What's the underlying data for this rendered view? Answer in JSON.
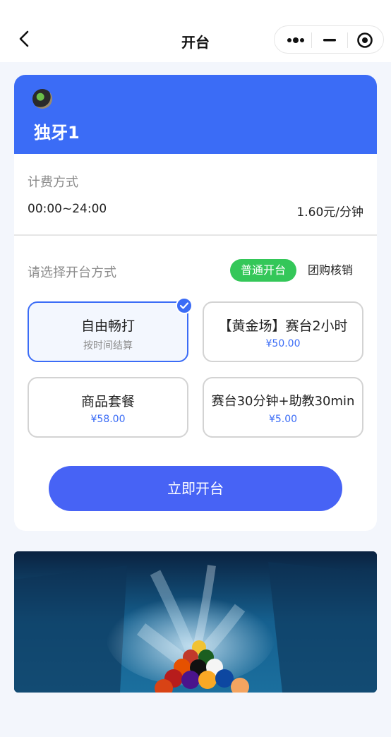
{
  "nav": {
    "title": "开台"
  },
  "table": {
    "name": "独牙1"
  },
  "billing": {
    "title": "计费方式",
    "time_range": "00:00~24:00",
    "price": "1.60元/分钟"
  },
  "mode": {
    "title": "请选择开台方式",
    "tabs": [
      "普通开台",
      "团购核销"
    ],
    "selected_tab": "普通开台"
  },
  "options": [
    {
      "name": "自由畅打",
      "sub": "按时间结算",
      "selected": true
    },
    {
      "name": "【黄金场】赛台2小时",
      "sub": "¥50.00",
      "selected": false
    },
    {
      "name": "商品套餐",
      "sub": "¥58.00",
      "selected": false
    },
    {
      "name": "赛台30分钟+助教30min",
      "sub": "¥5.00",
      "selected": false
    }
  ],
  "actions": {
    "start_label": "立即开台"
  },
  "colors": {
    "brand_blue": "#3b6cf6",
    "button_blue": "#4763f5",
    "active_tab_green": "#34c759",
    "background": "#f3f6fc"
  }
}
